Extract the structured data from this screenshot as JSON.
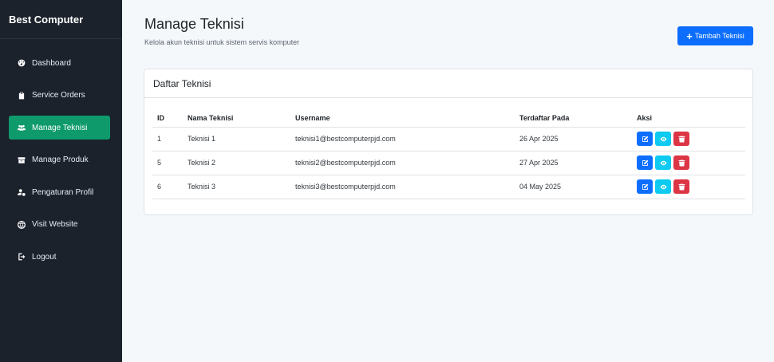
{
  "brand": "Best Computer",
  "nav": [
    {
      "label": "Dashboard",
      "icon": "gauge-icon",
      "active": false
    },
    {
      "label": "Service Orders",
      "icon": "clipboard-icon",
      "active": false
    },
    {
      "label": "Manage Teknisi",
      "icon": "users-icon",
      "active": true
    },
    {
      "label": "Manage Produk",
      "icon": "box-icon",
      "active": false
    },
    {
      "label": "Pengaturan Profil",
      "icon": "user-gear-icon",
      "active": false
    },
    {
      "label": "Visit Website",
      "icon": "globe-icon",
      "active": false
    },
    {
      "label": "Logout",
      "icon": "logout-icon",
      "active": false
    }
  ],
  "header": {
    "title": "Manage Teknisi",
    "subtitle": "Kelola akun teknisi untuk sistem servis komputer",
    "add_button": "Tambah Teknisi"
  },
  "card": {
    "title": "Daftar Teknisi",
    "columns": [
      "ID",
      "Nama Teknisi",
      "Username",
      "Terdaftar Pada",
      "Aksi"
    ],
    "rows": [
      {
        "id": "1",
        "name": "Teknisi 1",
        "username": "teknisi1@bestcomputerpjd.com",
        "date": "26 Apr 2025"
      },
      {
        "id": "5",
        "name": "Teknisi 2",
        "username": "teknisi2@bestcomputerpjd.com",
        "date": "27 Apr 2025"
      },
      {
        "id": "6",
        "name": "Teknisi 3",
        "username": "teknisi3@bestcomputerpjd.com",
        "date": "04 May 2025"
      }
    ]
  },
  "colors": {
    "sidebar_bg": "#1b222c",
    "active_nav": "#0f9a6b",
    "primary": "#0d6efd",
    "info": "#0dcaf0",
    "danger": "#dc3545"
  }
}
